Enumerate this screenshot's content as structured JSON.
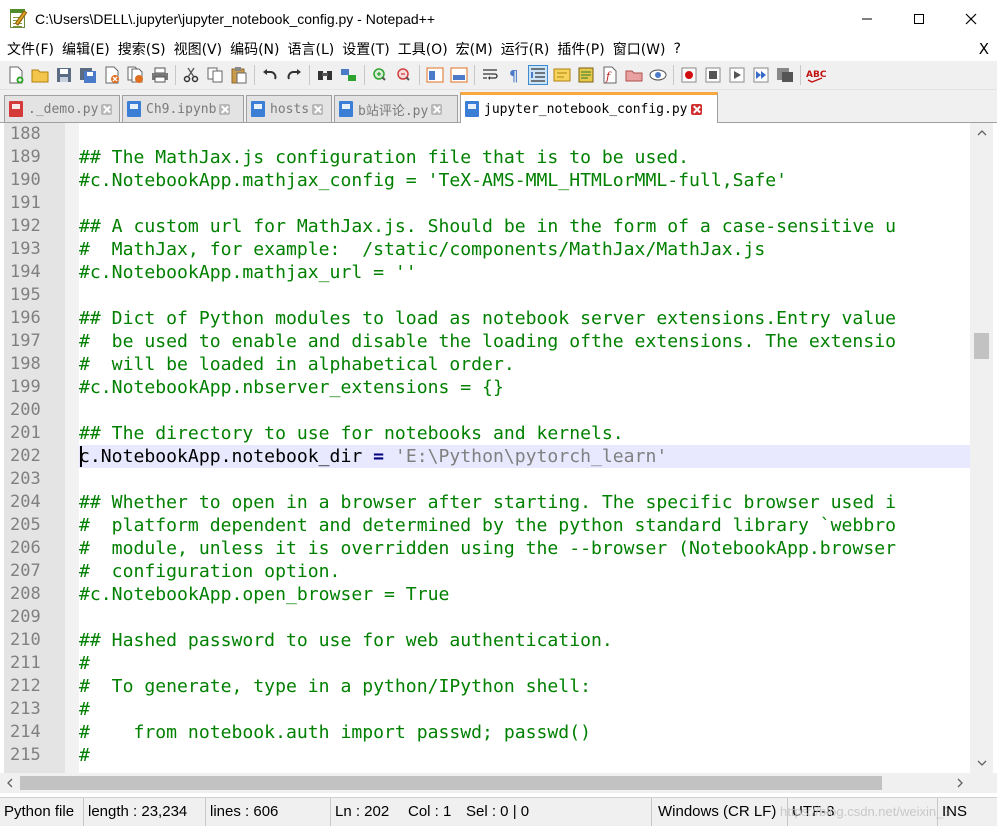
{
  "window": {
    "title": "C:\\Users\\DELL\\.jupyter\\jupyter_notebook_config.py - Notepad++"
  },
  "menu": {
    "items": [
      "文件(F)",
      "编辑(E)",
      "搜索(S)",
      "视图(V)",
      "编码(N)",
      "语言(L)",
      "设置(T)",
      "工具(O)",
      "宏(M)",
      "运行(R)",
      "插件(P)",
      "窗口(W)",
      "?"
    ],
    "close_label": "X"
  },
  "tabs": [
    {
      "label": "._demo.py",
      "icon": "file-blue-icon",
      "active": false
    },
    {
      "label": "Ch9.ipynb",
      "icon": "file-blue-icon",
      "active": false
    },
    {
      "label": "hosts",
      "icon": "file-blue-icon",
      "active": false
    },
    {
      "label": "b站评论.py",
      "icon": "file-blue-icon",
      "active": false
    },
    {
      "label": "jupyter_notebook_config.py",
      "icon": "file-blue-icon",
      "active": true
    }
  ],
  "editor": {
    "lines": [
      {
        "n": "188",
        "text": ""
      },
      {
        "n": "189",
        "text": "## The MathJax.js configuration file that is to be used."
      },
      {
        "n": "190",
        "text": "#c.NotebookApp.mathjax_config = 'TeX-AMS-MML_HTMLorMML-full,Safe'"
      },
      {
        "n": "191",
        "text": ""
      },
      {
        "n": "192",
        "text": "## A custom url for MathJax.js. Should be in the form of a case-sensitive u"
      },
      {
        "n": "193",
        "text": "#  MathJax, for example:  /static/components/MathJax/MathJax.js"
      },
      {
        "n": "194",
        "text": "#c.NotebookApp.mathjax_url = ''"
      },
      {
        "n": "195",
        "text": ""
      },
      {
        "n": "196",
        "text": "## Dict of Python modules to load as notebook server extensions.Entry value"
      },
      {
        "n": "197",
        "text": "#  be used to enable and disable the loading ofthe extensions. The extensio"
      },
      {
        "n": "198",
        "text": "#  will be loaded in alphabetical order."
      },
      {
        "n": "199",
        "text": "#c.NotebookApp.nbserver_extensions = {}"
      },
      {
        "n": "200",
        "text": ""
      },
      {
        "n": "201",
        "text": "## The directory to use for notebooks and kernels."
      },
      {
        "n": "202",
        "text": "",
        "code": {
          "name": "c.NotebookApp.notebook_dir ",
          "op": "=",
          "str": " 'E:\\Python\\pytorch_learn'"
        }
      },
      {
        "n": "203",
        "text": ""
      },
      {
        "n": "204",
        "text": "## Whether to open in a browser after starting. The specific browser used i"
      },
      {
        "n": "205",
        "text": "#  platform dependent and determined by the python standard library `webbro"
      },
      {
        "n": "206",
        "text": "#  module, unless it is overridden using the --browser (NotebookApp.browser"
      },
      {
        "n": "207",
        "text": "#  configuration option."
      },
      {
        "n": "208",
        "text": "#c.NotebookApp.open_browser = True"
      },
      {
        "n": "209",
        "text": ""
      },
      {
        "n": "210",
        "text": "## Hashed password to use for web authentication."
      },
      {
        "n": "211",
        "text": "#"
      },
      {
        "n": "212",
        "text": "#  To generate, type in a python/IPython shell:"
      },
      {
        "n": "213",
        "text": "#"
      },
      {
        "n": "214",
        "text": "#    from notebook.auth import passwd; passwd()"
      },
      {
        "n": "215",
        "text": "#"
      }
    ],
    "current_line": "202"
  },
  "status": {
    "file_type": "Python file",
    "length": "length : 23,234",
    "lines": "lines : 606",
    "ln": "Ln : 202",
    "col": "Col : 1",
    "sel": "Sel : 0 | 0",
    "eol": "Windows (CR LF)",
    "encoding": "UTF-8",
    "mode": "INS",
    "watermark": "https://blog.csdn.net/weixin_3"
  },
  "colors": {
    "comment": "#008000",
    "current_line": "#e8e8ff",
    "active_tab_accent": "#f7a940",
    "string": "#808080",
    "operator": "#000080"
  }
}
